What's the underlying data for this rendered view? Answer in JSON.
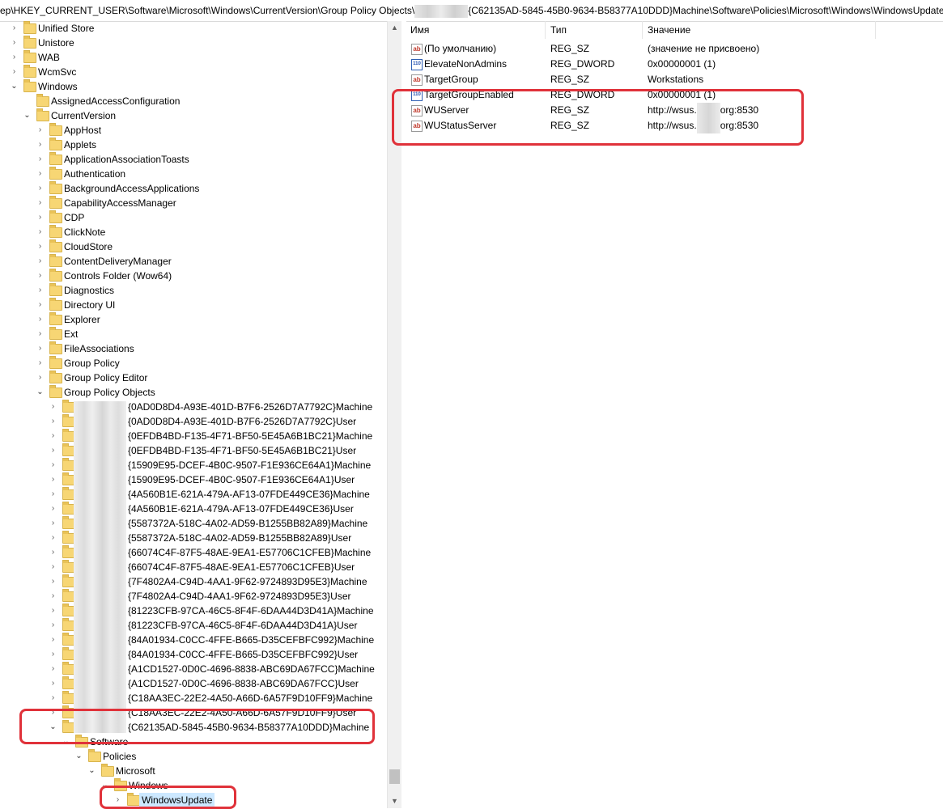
{
  "address": {
    "prefix": "ep\\HKEY_CURRENT_USER\\Software\\Microsoft\\Windows\\CurrentVersion\\Group Policy Objects\\",
    "suffix": "{C62135AD-5845-45B0-9634-B58377A10DDD}Machine\\Software\\Policies\\Microsoft\\Windows\\WindowsUpdate"
  },
  "tree": {
    "unified_store": "Unified Store",
    "unistore": "Unistore",
    "wab": "WAB",
    "wcmsvc": "WcmSvc",
    "windows": "Windows",
    "assigned": "AssignedAccessConfiguration",
    "currentversion": "CurrentVersion",
    "cv_children": [
      "AppHost",
      "Applets",
      "ApplicationAssociationToasts",
      "Authentication",
      "BackgroundAccessApplications",
      "CapabilityAccessManager",
      "CDP",
      "ClickNote",
      "CloudStore",
      "ContentDeliveryManager",
      "Controls Folder (Wow64)",
      "Diagnostics",
      "Directory UI",
      "Explorer",
      "Ext",
      "FileAssociations",
      "Group Policy",
      "Group Policy Editor",
      "Group Policy Objects"
    ],
    "gpo_children": [
      "{0AD0D8D4-A93E-401D-B7F6-2526D7A7792C}Machine",
      "{0AD0D8D4-A93E-401D-B7F6-2526D7A7792C}User",
      "{0EFDB4BD-F135-4F71-BF50-5E45A6B1BC21}Machine",
      "{0EFDB4BD-F135-4F71-BF50-5E45A6B1BC21}User",
      "{15909E95-DCEF-4B0C-9507-F1E936CE64A1}Machine",
      "{15909E95-DCEF-4B0C-9507-F1E936CE64A1}User",
      "{4A560B1E-621A-479A-AF13-07FDE449CE36}Machine",
      "{4A560B1E-621A-479A-AF13-07FDE449CE36}User",
      "{5587372A-518C-4A02-AD59-B1255BB82A89}Machine",
      "{5587372A-518C-4A02-AD59-B1255BB82A89}User",
      "{66074C4F-87F5-48AE-9EA1-E57706C1CFEB}Machine",
      "{66074C4F-87F5-48AE-9EA1-E57706C1CFEB}User",
      "{7F4802A4-C94D-4AA1-9F62-9724893D95E3}Machine",
      "{7F4802A4-C94D-4AA1-9F62-9724893D95E3}User",
      "{81223CFB-97CA-46C5-8F4F-6DAA44D3D41A}Machine",
      "{81223CFB-97CA-46C5-8F4F-6DAA44D3D41A}User",
      "{84A01934-C0CC-4FFE-B665-D35CEFBFC992}Machine",
      "{84A01934-C0CC-4FFE-B665-D35CEFBFC992}User",
      "{A1CD1527-0D0C-4696-8838-ABC69DA67FCC}Machine",
      "{A1CD1527-0D0C-4696-8838-ABC69DA67FCC}User",
      "{C18AA3EC-22E2-4A50-A66D-6A57F9D10FF9}Machine",
      "{C18AA3EC-22E2-4A50-A66D-6A57F9D10FF9}User",
      "{C62135AD-5845-45B0-9634-B58377A10DDD}Machine"
    ],
    "software": "Software",
    "policies": "Policies",
    "microsoft": "Microsoft",
    "windows2": "Windows",
    "windowsupdate": "WindowsUpdate"
  },
  "columns": {
    "name": "Имя",
    "type": "Тип",
    "value": "Значение"
  },
  "values": [
    {
      "name": "(По умолчанию)",
      "type": "REG_SZ",
      "data": "(значение не присвоено)",
      "icon": "string-value-icon"
    },
    {
      "name": "ElevateNonAdmins",
      "type": "REG_DWORD",
      "data": "0x00000001 (1)",
      "icon": "dword-value-icon"
    },
    {
      "name": "TargetGroup",
      "type": "REG_SZ",
      "data": "Workstations",
      "icon": "string-value-icon"
    },
    {
      "name": "TargetGroupEnabled",
      "type": "REG_DWORD",
      "data": "0x00000001 (1)",
      "icon": "dword-value-icon"
    },
    {
      "name": "WUServer",
      "type": "REG_SZ",
      "data_prefix": "http://wsus.",
      "data_suffix": "org:8530",
      "icon": "string-value-icon"
    },
    {
      "name": "WUStatusServer",
      "type": "REG_SZ",
      "data_prefix": "http://wsus.",
      "data_suffix": "org:8530",
      "icon": "string-value-icon"
    }
  ],
  "icons": {
    "string": "ab",
    "dword": "110"
  },
  "colors": {
    "highlight_box": "#e0323a",
    "selection": "#cce8ff",
    "folder": "#f7d674"
  }
}
